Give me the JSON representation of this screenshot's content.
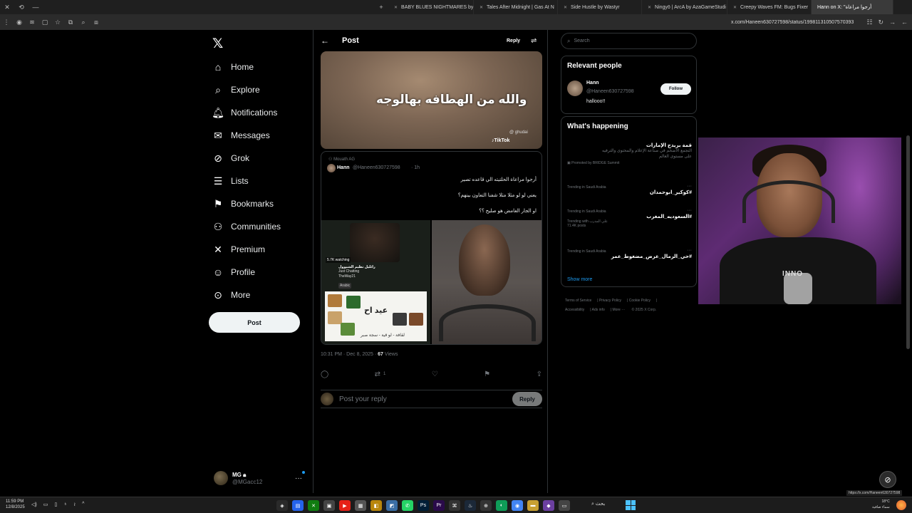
{
  "browser": {
    "tabs": [
      {
        "label": "BABY BLUES NIGHTMARES by"
      },
      {
        "label": "Tales After Midnight | Gas At N"
      },
      {
        "label": "Side Hustle by Wastyr"
      },
      {
        "label": "Ningyō | ArcA by AzaGameStudi"
      },
      {
        "label": "Creepy Waves FM: Bugs Fixer"
      },
      {
        "label": "Hann on X: \"أرجوا مراعاة"
      }
    ],
    "url": "x.com/Haneen630727598/status/199811310507570393"
  },
  "nav": {
    "items": [
      {
        "label": "Home",
        "icon": "home-icon"
      },
      {
        "label": "Explore",
        "icon": "search-icon"
      },
      {
        "label": "Notifications",
        "icon": "bell-icon"
      },
      {
        "label": "Messages",
        "icon": "envelope-icon"
      },
      {
        "label": "Grok",
        "icon": "grok-icon"
      },
      {
        "label": "Lists",
        "icon": "list-icon"
      },
      {
        "label": "Bookmarks",
        "icon": "bookmark-icon"
      },
      {
        "label": "Communities",
        "icon": "people-icon"
      },
      {
        "label": "Premium",
        "icon": "x-icon"
      },
      {
        "label": "Profile",
        "icon": "person-icon"
      },
      {
        "label": "More",
        "icon": "more-icon"
      }
    ],
    "post_button": "Post",
    "account": {
      "name": "MG",
      "handle": "@MGacc12"
    }
  },
  "post": {
    "header_title": "Post",
    "header_reply": "Reply",
    "video_caption": "والله من الهطافه بهالوجه",
    "video_watermark": "@ ghudai",
    "video_tiktok": "TikTok",
    "quote": {
      "reposter": "Mouath AG",
      "name": "Hann",
      "handle": "@Haneen630727598",
      "time": "1h",
      "lines": [
        "أرجوا مراعاة الحلتيته الي قاعده تصير",
        "يعني لو لو مثلا مثلا شفنا التعاون بينهم؟",
        "او الجار الغامض هو صليح ؟؟"
      ],
      "media1": {
        "watching": "5.7K watching",
        "channel": "رائليل تطيم الشيوول",
        "sub1": "Just Chatting",
        "sub2": "TheWay21",
        "lang": "Arabic",
        "board_title": "عيد اح",
        "board_bottom": "لقافة - لو قية - سجة صبر"
      }
    },
    "meta_time": "10:31 PM · Dec 8, 2025 · ",
    "meta_views": "67",
    "meta_views_label": " Views",
    "retweet_count": "1",
    "reply_placeholder": "Post your reply",
    "reply_button": "Reply"
  },
  "sidebar": {
    "search_placeholder": "Search",
    "relevant_title": "Relevant people",
    "person": {
      "name": "Hann",
      "handle": "@Haneen630727598",
      "bio": "hallooo!!",
      "follow": "Follow"
    },
    "happening_title": "What's happening",
    "promo": {
      "title": "قمة بريدج الإمارات",
      "desc1": "التجمع الأضخم في صناعة الإعلام والمحتوى والترفيه",
      "desc2": "على مستوى العالم",
      "by": "Promoted by BRIDGE Summit"
    },
    "trends": [
      {
        "context": "Trending in Saudi Arabia",
        "title": "#كوكير_ابوحمدان",
        "sub": ""
      },
      {
        "context": "Trending in Saudi Arabia",
        "title": "#السعوديه_المغرب",
        "sub": "Trending with علي المدرب",
        "sub2": "71.4K posts"
      },
      {
        "context": "Trending in Saudi Arabia",
        "title": "#حي_الرمال_عرض_مضغوط_عمر",
        "sub": ""
      }
    ],
    "show_more": "Show more",
    "footer": [
      "Terms of Service",
      "Privacy Policy",
      "Cookie Policy",
      "Accessibility",
      "Ads info",
      "More ···",
      "© 2025 X Corp."
    ]
  },
  "overlay": {
    "cam_brand": "INNO",
    "status_url": "https://x.com/Haneen630727598"
  },
  "taskbar": {
    "time": "11:59 PM",
    "date": "12/8/2025",
    "search_label": "بحث",
    "weather_temp": "18°C",
    "weather_desc": "سماء صافية"
  }
}
